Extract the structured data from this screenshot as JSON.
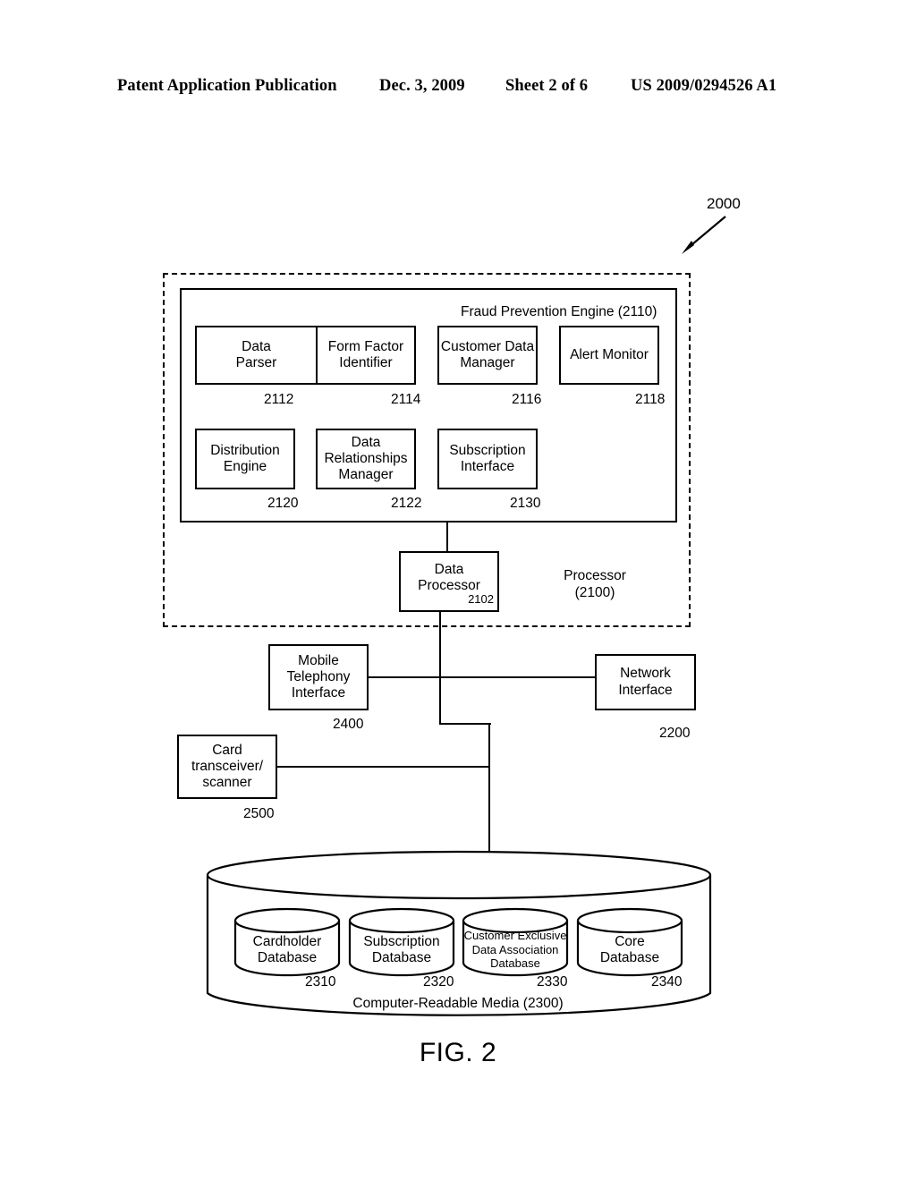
{
  "header": {
    "publication": "Patent Application Publication",
    "date": "Dec. 3, 2009",
    "sheet": "Sheet 2 of 6",
    "patent_number": "US 2009/0294526 A1"
  },
  "figure": {
    "caption": "FIG. 2",
    "system_ref": "2000"
  },
  "fraud_prevention_engine": {
    "title": "Fraud Prevention Engine (2110)",
    "modules": [
      {
        "label_line1": "Data",
        "label_line2": "Parser",
        "label_line3": "",
        "ref": "2112"
      },
      {
        "label_line1": "Form Factor",
        "label_line2": "Identifier",
        "label_line3": "",
        "ref": "2114"
      },
      {
        "label_line1": "Customer Data",
        "label_line2": "Manager",
        "label_line3": "",
        "ref": "2116"
      },
      {
        "label_line1": "Alert Monitor",
        "label_line2": "",
        "label_line3": "",
        "ref": "2118"
      },
      {
        "label_line1": "Distribution",
        "label_line2": "Engine",
        "label_line3": "",
        "ref": "2120"
      },
      {
        "label_line1": "Data",
        "label_line2": "Relationships",
        "label_line3": "Manager",
        "ref": "2122"
      },
      {
        "label_line1": "Subscription",
        "label_line2": "Interface",
        "label_line3": "",
        "ref": "2130"
      }
    ]
  },
  "processor": {
    "title_line1": "Processor",
    "title_line2": "(2100)",
    "data_processor": {
      "label_line1": "Data",
      "label_line2": "Processor",
      "ref": "2102"
    }
  },
  "interfaces": [
    {
      "label_line1": "Mobile",
      "label_line2": "Telephony",
      "label_line3": "Interface",
      "ref": "2400"
    },
    {
      "label_line1": "Network",
      "label_line2": "Interface",
      "label_line3": "",
      "ref": "2200"
    },
    {
      "label_line1": "Card",
      "label_line2": "transceiver/",
      "label_line3": "scanner",
      "ref": "2500"
    }
  ],
  "storage": {
    "title": "Computer-Readable Media (2300)",
    "databases": [
      {
        "line1": "Cardholder",
        "line2": "Database",
        "line3": "",
        "ref": "2310"
      },
      {
        "line1": "Subscription",
        "line2": "Database",
        "line3": "",
        "ref": "2320"
      },
      {
        "line1": "Customer Exclusive",
        "line2": "Data Association",
        "line3": "Database",
        "ref": "2330"
      },
      {
        "line1": "Core",
        "line2": "Database",
        "line3": "",
        "ref": "2340"
      }
    ]
  }
}
